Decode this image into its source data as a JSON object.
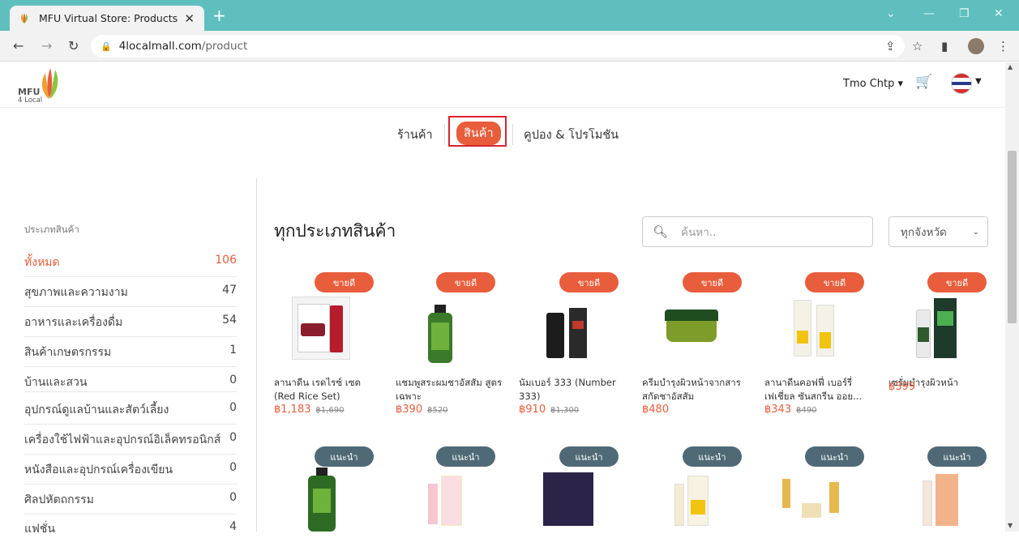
{
  "browser": {
    "tab_title": "MFU Virtual Store: Products",
    "tab_close": "✕",
    "new_tab": "+",
    "url_domain": "4localmall.com",
    "url_path": "/product"
  },
  "header": {
    "logo_text_1": "MFU",
    "logo_text_2": "4 Local",
    "user_name": "Tmo Chtp",
    "user_caret": "▾"
  },
  "nav_tabs": {
    "shops": "ร้านค้า",
    "products": "สินค้า",
    "coupons": "คูปอง & โปรโมชัน"
  },
  "sidebar": {
    "title": "ประเภทสินค้า",
    "categories": [
      {
        "label": "ทั้งหมด",
        "count": "106"
      },
      {
        "label": "สุขภาพและความงาม",
        "count": "47"
      },
      {
        "label": "อาหารและเครื่องดื่ม",
        "count": "54"
      },
      {
        "label": "สินค้าเกษตรกรรม",
        "count": "1"
      },
      {
        "label": "บ้านและสวน",
        "count": "0"
      },
      {
        "label": "อุปกรณ์ดูแลบ้านและสัตว์เลี้ยง",
        "count": "0"
      },
      {
        "label": "เครื่องใช้ไฟฟ้าและอุปกรณ์อิเล็คทรอนิกส์",
        "count": "0"
      },
      {
        "label": "หนังสือและอุปกรณ์เครื่องเขียน",
        "count": "0"
      },
      {
        "label": "ศิลปหัตถกรรม",
        "count": "0"
      },
      {
        "label": "แฟชั่น",
        "count": "4"
      }
    ]
  },
  "main": {
    "title": "ทุกประเภทสินค้า",
    "search_placeholder": "ค้นหา..",
    "province_select": "ทุกจังหวัด"
  },
  "products_row1": [
    {
      "badge": "ขายดี",
      "name": "ลานาดีน เรดไรซ์ เซต (Red Rice Set)",
      "price": "฿1,183",
      "old_price": "฿1,690"
    },
    {
      "badge": "ขายดี",
      "name": "แชมพูสระผมชาอัสสัม สูตรเฉพาะ",
      "price": "฿390",
      "old_price": "฿520"
    },
    {
      "badge": "ขายดี",
      "name": "นัมเบอร์ 333 (Number 333)",
      "price": "฿910",
      "old_price": "฿1,300"
    },
    {
      "badge": "ขายดี",
      "name": "ครีมบำรุงผิวหน้าจากสารสกัดชาอัสสัม",
      "price": "฿480",
      "old_price": ""
    },
    {
      "badge": "ขายดี",
      "name": "ลานาดีนคอฟฟี่ เบอร์รี่ เฟเชี่ยล ซันสกรีน ออย...",
      "price": "฿343",
      "old_price": "฿490"
    },
    {
      "badge": "ขายดี",
      "name": "เซรั่มบำรุงผิวหน้า",
      "price": "฿399",
      "old_price": ""
    }
  ],
  "products_row2": [
    {
      "badge": "แนะนำ"
    },
    {
      "badge": "แนะนำ"
    },
    {
      "badge": "แนะนำ"
    },
    {
      "badge": "แนะนำ"
    },
    {
      "badge": "แนะนำ"
    },
    {
      "badge": "แนะนำ"
    }
  ],
  "colors": {
    "accent": "#e85d3c",
    "recommend_badge": "#4f6a76",
    "browser_tabbar": "#5ebfbe",
    "highlight_box": "#d9232d"
  }
}
